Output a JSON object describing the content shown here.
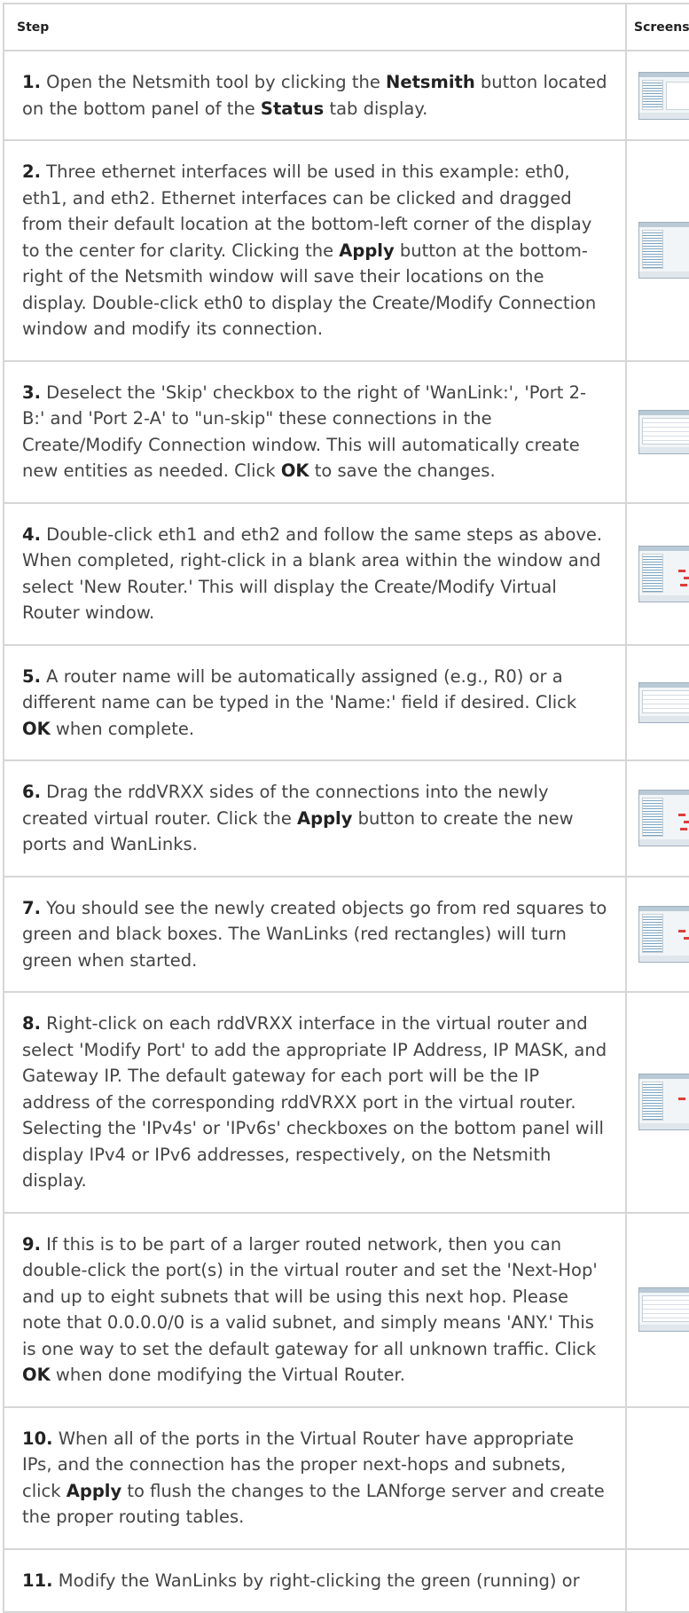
{
  "table": {
    "header_step": "Step",
    "header_screenshot": "Screenshot"
  },
  "steps": [
    {
      "num": "1.",
      "parts": [
        {
          "t": " Open the Netsmith tool by clicking the "
        },
        {
          "b": "Netsmith"
        },
        {
          "t": " button located on the bottom panel of the "
        },
        {
          "b": "Status"
        },
        {
          "t": " tab display."
        }
      ]
    },
    {
      "num": "2.",
      "parts": [
        {
          "t": " Three ethernet interfaces will be used in this example: eth0, eth1, and eth2. Ethernet interfaces can be clicked and dragged from their default location at the bottom-left corner of the display to the center for clarity. Clicking the "
        },
        {
          "b": "Apply"
        },
        {
          "t": " button at the bottom-right of the Netsmith window will save their locations on the display. Double-click eth0 to display the Create/Modify Connection window and modify its connection."
        }
      ]
    },
    {
      "num": "3.",
      "parts": [
        {
          "t": " Deselect the 'Skip' checkbox to the right of 'WanLink:', 'Port 2-B:' and 'Port 2-A' to \"un-skip\" these connections in the Create/Modify Connection window. This will automatically create new entities as needed. Click "
        },
        {
          "b": "OK"
        },
        {
          "t": " to save the changes."
        }
      ]
    },
    {
      "num": "4.",
      "parts": [
        {
          "t": " Double-click eth1 and eth2 and follow the same steps as above. When completed, right-click in a blank area within the window and select 'New Router.' This will display the Create/Modify Virtual Router window."
        }
      ]
    },
    {
      "num": "5.",
      "parts": [
        {
          "t": " A router name will be automatically assigned (e.g., R0) or a different name can be typed in the 'Name:' field if desired. Click "
        },
        {
          "b": "OK"
        },
        {
          "t": " when complete."
        }
      ]
    },
    {
      "num": "6.",
      "parts": [
        {
          "t": " Drag the rddVRXX sides of the connections into the newly created virtual router. Click the "
        },
        {
          "b": "Apply"
        },
        {
          "t": " button to create the new ports and WanLinks."
        }
      ]
    },
    {
      "num": "7.",
      "parts": [
        {
          "t": " You should see the newly created objects go from red squares to green and black boxes. The WanLinks (red rectangles) will turn green when started."
        }
      ]
    },
    {
      "num": "8.",
      "parts": [
        {
          "t": " Right-click on each rddVRXX interface in the virtual router and select 'Modify Port' to add the appropriate IP Address, IP MASK, and Gateway IP. The default gateway for each port will be the IP address of the corresponding rddVRXX port in the virtual router. Selecting the 'IPv4s' or 'IPv6s' checkboxes on the bottom panel will display IPv4 or IPv6 addresses, respectively, on the Netsmith display."
        }
      ]
    },
    {
      "num": "9.",
      "parts": [
        {
          "t": " If this is to be part of a larger routed network, then you can double-click the port(s) in the virtual router and set the 'Next-Hop' and up to eight subnets that will be using this next hop. Please note that 0.0.0.0/0 is a valid subnet, and simply means 'ANY.' This is one way to set the default gateway for all unknown traffic. Click "
        },
        {
          "b": "OK"
        },
        {
          "t": " when done modifying the Virtual Router."
        }
      ]
    },
    {
      "num": "10.",
      "parts": [
        {
          "t": " When all of the ports in the Virtual Router have appropriate IPs, and the connection has the proper next-hops and subnets, click "
        },
        {
          "b": "Apply"
        },
        {
          "t": " to flush the changes to the LANforge server and create the proper routing tables."
        }
      ]
    },
    {
      "num": "11.",
      "parts": [
        {
          "t": " Modify the WanLinks by right-clicking the green (running) or"
        }
      ]
    }
  ]
}
